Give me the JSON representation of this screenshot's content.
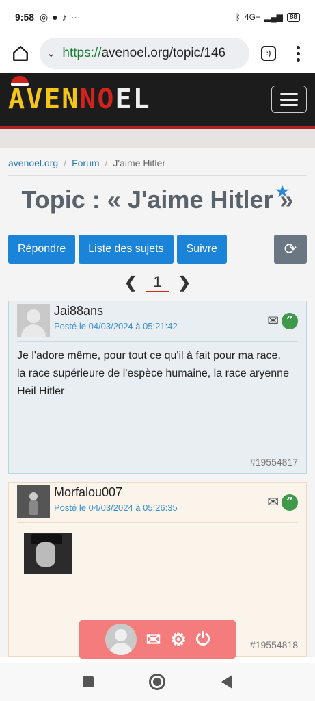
{
  "status_bar": {
    "time": "9:58",
    "network": "4G+",
    "battery": "88"
  },
  "browser": {
    "url_scheme": "https://",
    "url_rest": "avenoel.org/topic/146",
    "tab_count": ":)"
  },
  "site": {
    "logo_parts": [
      "AVEN",
      "NO",
      "EL"
    ]
  },
  "breadcrumb": {
    "home": "avenoel.org",
    "forum": "Forum",
    "current": "J'aime Hitler",
    "separator": "/"
  },
  "topic": {
    "title": "Topic : « J'aime Hitler »",
    "star": "★"
  },
  "buttons": {
    "reply": "Répondre",
    "list": "Liste des sujets",
    "follow": "Suivre",
    "refresh": "⟳"
  },
  "pagination": {
    "prev": "❮",
    "current": "1",
    "next": "❯"
  },
  "posts": [
    {
      "username": "Jai88ans",
      "date": "Posté le 04/03/2024 à 05:21:42",
      "body_lines": [
        "Je l'adore même, pour tout ce qu'il à fait pour ma race,",
        "la race supérieure de l'espèce humaine, la race aryenne",
        "Heil Hitler"
      ],
      "id": "#19554817"
    },
    {
      "username": "Morfalou007",
      "date": "Posté le 04/03/2024 à 05:26:35",
      "id": "#19554818"
    }
  ],
  "icons": {
    "mail": "✉",
    "quote": "”",
    "settings": "⚙",
    "power": "⏻"
  }
}
